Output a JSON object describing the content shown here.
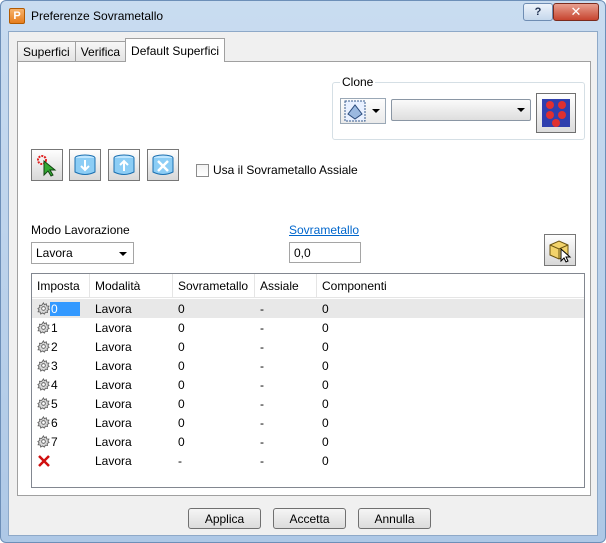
{
  "window": {
    "title": "Preferenze Sovrametallo",
    "app_icon": "P",
    "help_glyph": "?",
    "close_glyph": "✕"
  },
  "tabs": [
    {
      "label": "Superfici"
    },
    {
      "label": "Verifica"
    },
    {
      "label": "Default Superfici",
      "active": true
    }
  ],
  "clone": {
    "label": "Clone",
    "selected": ""
  },
  "checkbox": {
    "label": "Usa il Sovrametallo Assiale",
    "checked": false
  },
  "mode": {
    "label": "Modo Lavorazione",
    "value": "Lavora"
  },
  "sovrametallo": {
    "link": "Sovrametallo",
    "value": "0,0"
  },
  "grid": {
    "columns": [
      "Imposta",
      "Modalità",
      "Sovrametallo",
      "Assiale",
      "Componenti"
    ],
    "rows": [
      {
        "icon": "gear-icon",
        "id": "0",
        "mode": "Lavora",
        "sovr": "0",
        "assiale": "-",
        "comp": "0"
      },
      {
        "icon": "gear-icon",
        "id": "1",
        "mode": "Lavora",
        "sovr": "0",
        "assiale": "-",
        "comp": "0"
      },
      {
        "icon": "gear-icon",
        "id": "2",
        "mode": "Lavora",
        "sovr": "0",
        "assiale": "-",
        "comp": "0"
      },
      {
        "icon": "gear-icon",
        "id": "3",
        "mode": "Lavora",
        "sovr": "0",
        "assiale": "-",
        "comp": "0"
      },
      {
        "icon": "gear-icon",
        "id": "4",
        "mode": "Lavora",
        "sovr": "0",
        "assiale": "-",
        "comp": "0"
      },
      {
        "icon": "gear-icon",
        "id": "5",
        "mode": "Lavora",
        "sovr": "0",
        "assiale": "-",
        "comp": "0"
      },
      {
        "icon": "gear-icon",
        "id": "6",
        "mode": "Lavora",
        "sovr": "0",
        "assiale": "-",
        "comp": "0"
      },
      {
        "icon": "gear-icon",
        "id": "7",
        "mode": "Lavora",
        "sovr": "0",
        "assiale": "-",
        "comp": "0"
      },
      {
        "icon": "red-x-icon",
        "id": "",
        "mode": "Lavora",
        "sovr": "-",
        "assiale": "-",
        "comp": "0"
      }
    ]
  },
  "buttons": {
    "apply": "Applica",
    "accept": "Accetta",
    "cancel": "Annulla"
  }
}
